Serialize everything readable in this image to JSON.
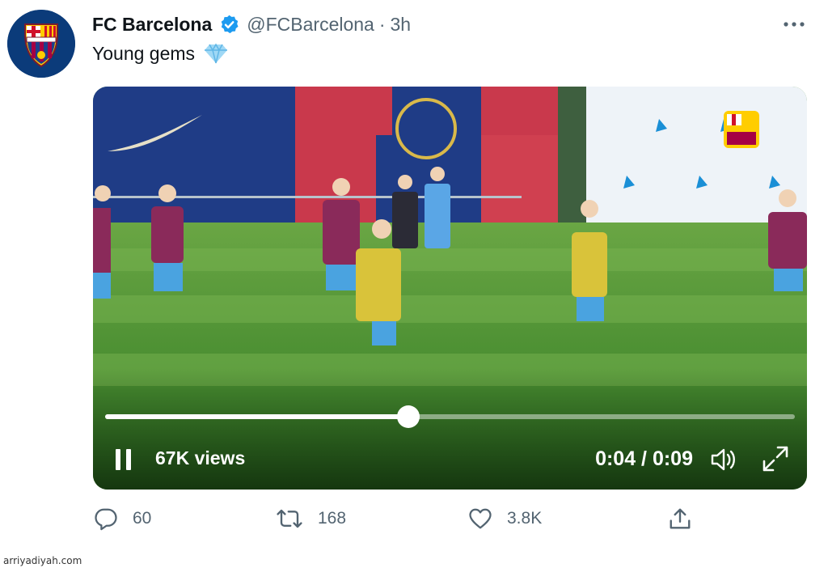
{
  "tweet": {
    "author_name": "FC Barcelona",
    "handle": "@FCBarcelona",
    "separator": "·",
    "time": "3h",
    "text": "Young gems",
    "avatar_icon": "fc-barcelona-crest",
    "verified_icon": "verified-badge-icon",
    "emoji_icon": "gem-icon"
  },
  "video": {
    "views": "67K views",
    "timecode": "0:04 / 0:09",
    "progress_fraction": 0.44
  },
  "actions": {
    "reply_count": "60",
    "retweet_count": "168",
    "like_count": "3.8K"
  },
  "colors": {
    "accent_blue": "#1d9bf0",
    "secondary_text": "#536471",
    "barca_blue": "#0a3a78",
    "barca_red": "#a50044"
  },
  "watermark": "arriyadiyah.com"
}
